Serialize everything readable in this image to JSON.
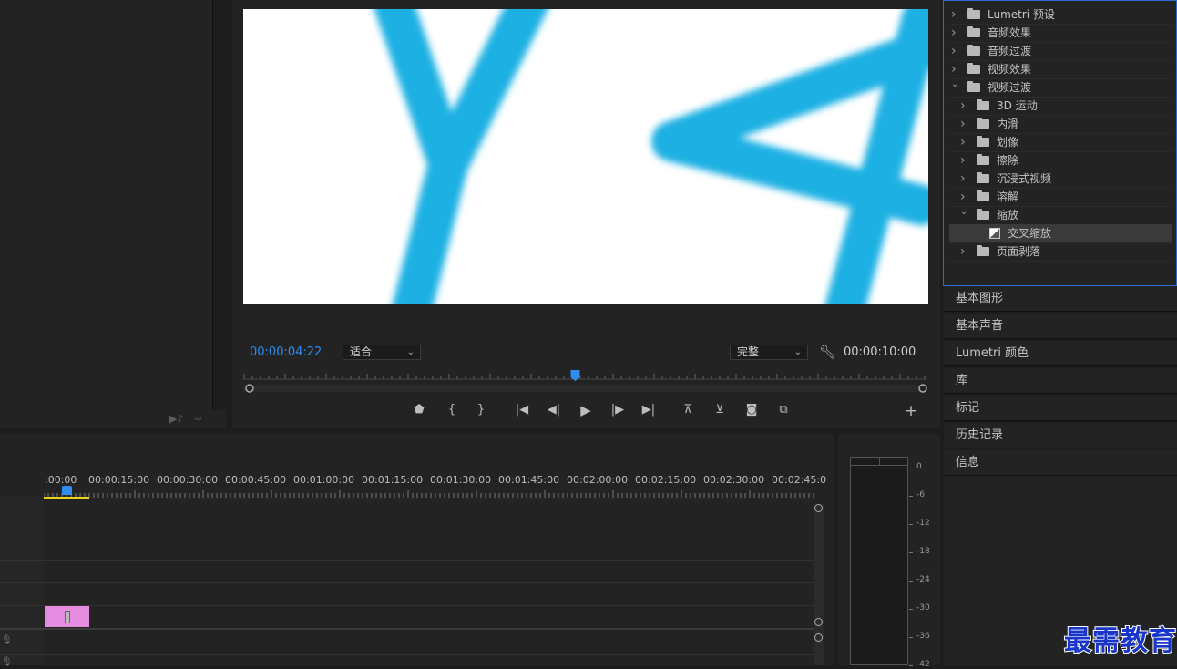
{
  "program_monitor": {
    "current_timecode": "00:00:04:22",
    "fit_dropdown": "适合",
    "quality_dropdown": "完整",
    "duration_timecode": "00:00:10:00",
    "playhead_fraction": 0.49,
    "controls": [
      "marker-icon",
      "mark-in-icon",
      "mark-out-icon",
      "go-to-in-icon",
      "step-back-icon",
      "play-icon",
      "step-forward-icon",
      "go-to-out-icon",
      "lift-icon",
      "extract-icon",
      "camera-icon",
      "comparison-icon",
      "add-icon"
    ]
  },
  "effects_panel": {
    "items": [
      {
        "label": "Lumetri 预设",
        "expanded": false,
        "level": 0
      },
      {
        "label": "音频效果",
        "expanded": false,
        "level": 0
      },
      {
        "label": "音频过渡",
        "expanded": false,
        "level": 0
      },
      {
        "label": "视频效果",
        "expanded": false,
        "level": 0
      },
      {
        "label": "视频过渡",
        "expanded": true,
        "level": 0
      },
      {
        "label": "3D 运动",
        "expanded": false,
        "level": 1
      },
      {
        "label": "内滑",
        "expanded": false,
        "level": 1
      },
      {
        "label": "划像",
        "expanded": false,
        "level": 1
      },
      {
        "label": "擦除",
        "expanded": false,
        "level": 1
      },
      {
        "label": "沉浸式视频",
        "expanded": false,
        "level": 1
      },
      {
        "label": "溶解",
        "expanded": false,
        "level": 1
      },
      {
        "label": "缩放",
        "expanded": true,
        "level": 1
      },
      {
        "label": "交叉缩放",
        "expanded": false,
        "level": 2,
        "selected": true
      },
      {
        "label": "页面剥落",
        "expanded": false,
        "level": 1
      }
    ]
  },
  "side_panels": [
    "基本图形",
    "基本声音",
    "Lumetri 颜色",
    "库",
    "标记",
    "历史记录",
    "信息"
  ],
  "timeline": {
    "ruler_labels": [
      ":00:00",
      "00:00:15:00",
      "00:00:30:00",
      "00:00:45:00",
      "00:01:00:00",
      "00:01:15:00",
      "00:01:30:00",
      "00:01:45:00",
      "00:02:00:00",
      "00:02:15:00",
      "00:02:30:00",
      "00:02:45:0"
    ],
    "clip_color": "#e58be0",
    "playhead_color": "#2d8cf0"
  },
  "audio_meter": {
    "db_labels": [
      "0",
      "-6",
      "-12",
      "-18",
      "-24",
      "-30",
      "-36",
      "-42"
    ]
  },
  "watermark": "最需教育",
  "colors": {
    "accent": "#2d8cf0",
    "stroke_blue": "#1eb0e3"
  }
}
